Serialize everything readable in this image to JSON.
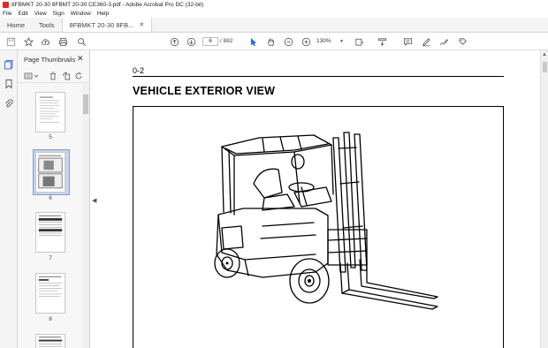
{
  "window": {
    "title": "8FBMKT 20-30 8FBMT 20-30 CE360-3.pdf - Adobe Acrobat Pro DC (32-bit)"
  },
  "menu": [
    "File",
    "Edit",
    "View",
    "Sign",
    "Window",
    "Help"
  ],
  "tabs": {
    "home": "Home",
    "tools": "Tools",
    "document": "8FBMKT 20-30 8FB..."
  },
  "toolbar": {
    "current_page": "6",
    "page_total": "/ 882",
    "zoom": "130%"
  },
  "panel": {
    "title": "Page Thumbnails",
    "thumbnails": [
      {
        "label": "5"
      },
      {
        "label": "6",
        "selected": true
      },
      {
        "label": "7"
      },
      {
        "label": "8"
      }
    ]
  },
  "page": {
    "section_number": "0-2",
    "heading": "VEHICLE EXTERIOR VIEW"
  },
  "colors": {
    "accent": "#d92b1f",
    "selection": "#c9d4e6",
    "selection_border": "#7f9ccc"
  }
}
